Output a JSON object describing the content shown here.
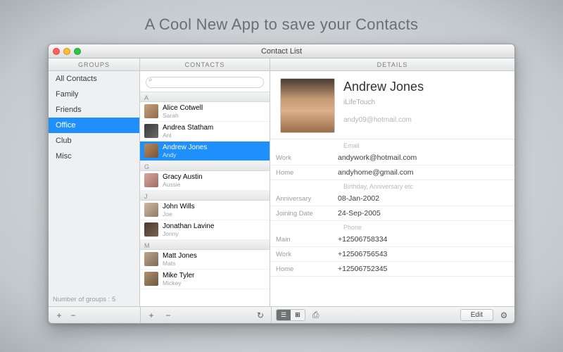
{
  "tagline": "A Cool New App to save your Contacts",
  "window_title": "Contact List",
  "headers": {
    "groups": "GROUPS",
    "contacts": "CONTACTS",
    "details": "DETAILS"
  },
  "groups": {
    "items": [
      "All Contacts",
      "Family",
      "Friends",
      "Office",
      "Club",
      "Misc"
    ],
    "selected_index": 3,
    "footer": "Number of groups : 5"
  },
  "search": {
    "placeholder": ""
  },
  "contacts": {
    "selected_index": 2,
    "sections": [
      {
        "letter": "A",
        "items": [
          {
            "name": "Alice Cotwell",
            "nick": "Sarah",
            "av": "av0"
          },
          {
            "name": "Andrea  Statham",
            "nick": "Ant",
            "av": "av1"
          },
          {
            "name": "Andrew Jones",
            "nick": "Andy",
            "av": "av2"
          }
        ]
      },
      {
        "letter": "G",
        "items": [
          {
            "name": "Gracy  Austin",
            "nick": "Aussie",
            "av": "av3"
          }
        ]
      },
      {
        "letter": "J",
        "items": [
          {
            "name": "John  Wills",
            "nick": "Joe",
            "av": "av4"
          },
          {
            "name": "Jonathan  Lavine",
            "nick": "Jonny",
            "av": "av5"
          }
        ]
      },
      {
        "letter": "M",
        "items": [
          {
            "name": "Matt Jones",
            "nick": "Mats",
            "av": "av6"
          },
          {
            "name": "Mike Tyler",
            "nick": "Mickey",
            "av": "av7"
          }
        ]
      }
    ]
  },
  "details": {
    "name": "Andrew Jones",
    "org": "iLifeTouch",
    "primary_email": "andy09@hotmail.com",
    "sections": [
      {
        "title": "Email",
        "rows": [
          {
            "label": "Work",
            "value": "andywork@hotmail.com"
          },
          {
            "label": "Home",
            "value": "andyhome@gmail.com"
          }
        ]
      },
      {
        "title": "Birthday, Anniversary etc",
        "rows": [
          {
            "label": "Anniversary",
            "value": "08-Jan-2002"
          },
          {
            "label": "Joining Date",
            "value": "24-Sep-2005"
          }
        ]
      },
      {
        "title": "Phone",
        "rows": [
          {
            "label": "Main",
            "value": "+12506758334"
          },
          {
            "label": "Work",
            "value": "+12506756543"
          },
          {
            "label": "Home",
            "value": "+12506752345"
          }
        ]
      }
    ]
  },
  "footer": {
    "edit": "Edit",
    "view_modes": [
      "☰",
      "⊞"
    ]
  }
}
